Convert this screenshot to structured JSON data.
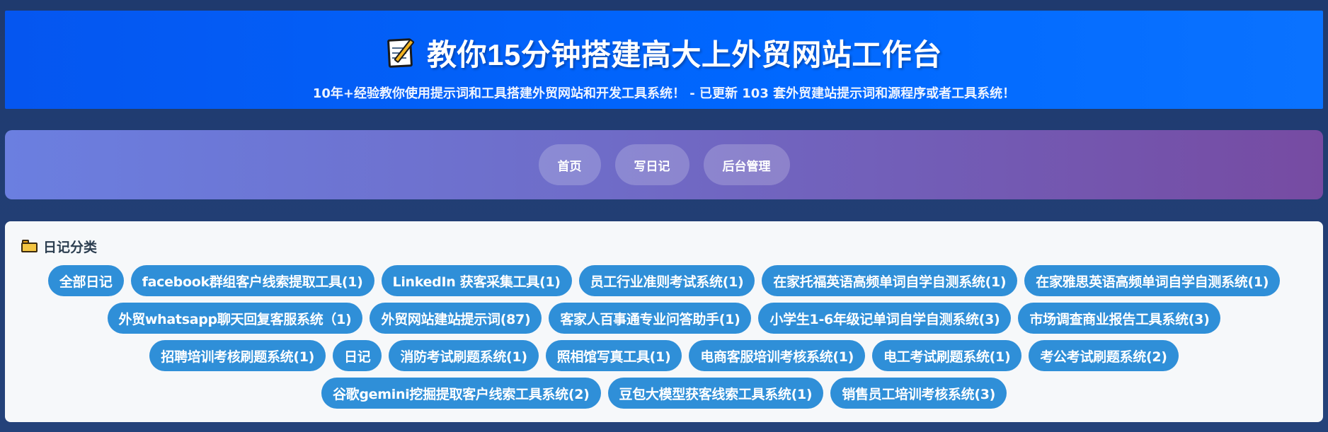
{
  "header": {
    "icon": "memo-icon",
    "title": "教你15分钟搭建高大上外贸网站工作台",
    "subtitle": "10年+经验教你使用提示词和工具搭建外贸网站和开发工具系统！ - 已更新 103 套外贸建站提示词和源程序或者工具系统！"
  },
  "nav": {
    "items": [
      {
        "label": "首页"
      },
      {
        "label": "写日记"
      },
      {
        "label": "后台管理"
      }
    ]
  },
  "categories": {
    "icon": "folder-icon",
    "title": "日记分类",
    "tags": [
      {
        "label": "全部日记"
      },
      {
        "label": "facebook群组客户线索提取工具(1)"
      },
      {
        "label": "LinkedIn 获客采集工具(1)"
      },
      {
        "label": "员工行业准则考试系统(1)"
      },
      {
        "label": "在家托福英语高频单词自学自测系统(1)"
      },
      {
        "label": "在家雅思英语高频单词自学自测系统(1)"
      },
      {
        "label": "外贸whatsapp聊天回复客服系统（1)"
      },
      {
        "label": "外贸网站建站提示词(87)"
      },
      {
        "label": "客家人百事通专业问答助手(1)"
      },
      {
        "label": "小学生1-6年级记单词自学自测系统(3)"
      },
      {
        "label": "市场调查商业报告工具系统(3)"
      },
      {
        "label": "招聘培训考核刷题系统(1)"
      },
      {
        "label": "日记"
      },
      {
        "label": "消防考试刷题系统(1)"
      },
      {
        "label": "照相馆写真工具(1)"
      },
      {
        "label": "电商客服培训考核系统(1)"
      },
      {
        "label": "电工考试刷题系统(1)"
      },
      {
        "label": "考公考试刷题系统(2)"
      },
      {
        "label": "谷歌gemini挖掘提取客户线索工具系统(2)"
      },
      {
        "label": "豆包大模型获客线索工具系统(1)"
      },
      {
        "label": "销售员工培训考核系统(3)"
      }
    ]
  },
  "colors": {
    "header_bg": "#0068ff",
    "nav_gradient_start": "#6b7fe0",
    "nav_gradient_end": "#764ba2",
    "tag_bg": "#2f8fd8",
    "panel_bg": "#f6f8fa",
    "page_bg": "#223a6e"
  }
}
